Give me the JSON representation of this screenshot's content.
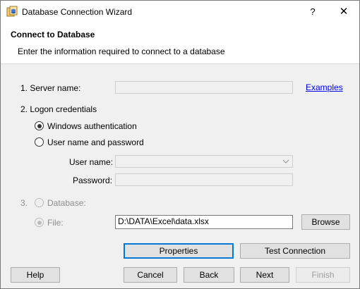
{
  "window": {
    "title": "Database Connection Wizard",
    "help_glyph": "?",
    "close_glyph": "✕"
  },
  "header": {
    "title": "Connect to Database",
    "description": "Enter the information required to connect to a database"
  },
  "server": {
    "label": "1. Server name:",
    "value": "",
    "examples_link": "Examples"
  },
  "logon": {
    "label": "2. Logon credentials",
    "windows_auth": {
      "label": "Windows authentication",
      "checked": true
    },
    "user_pass": {
      "label": "User name and password",
      "checked": false
    },
    "username_label": "User name:",
    "username_value": "",
    "password_label": "Password:",
    "password_value": ""
  },
  "section3": {
    "number": "3.",
    "database_label": "Database:",
    "file_label": "File:",
    "file_value": "D:\\DATA\\Excel\\data.xlsx",
    "browse_label": "Browse"
  },
  "buttons": {
    "properties": "Properties",
    "test_connection": "Test Connection",
    "help": "Help",
    "cancel": "Cancel",
    "back": "Back",
    "next": "Next",
    "finish": "Finish"
  },
  "icons": {
    "app": "database-wizard-icon",
    "combo_arrow": "chevron-down-icon"
  },
  "colors": {
    "link": "#0000ee",
    "default_button_border": "#0078d7",
    "disabled_text": "#8d8d8d"
  }
}
